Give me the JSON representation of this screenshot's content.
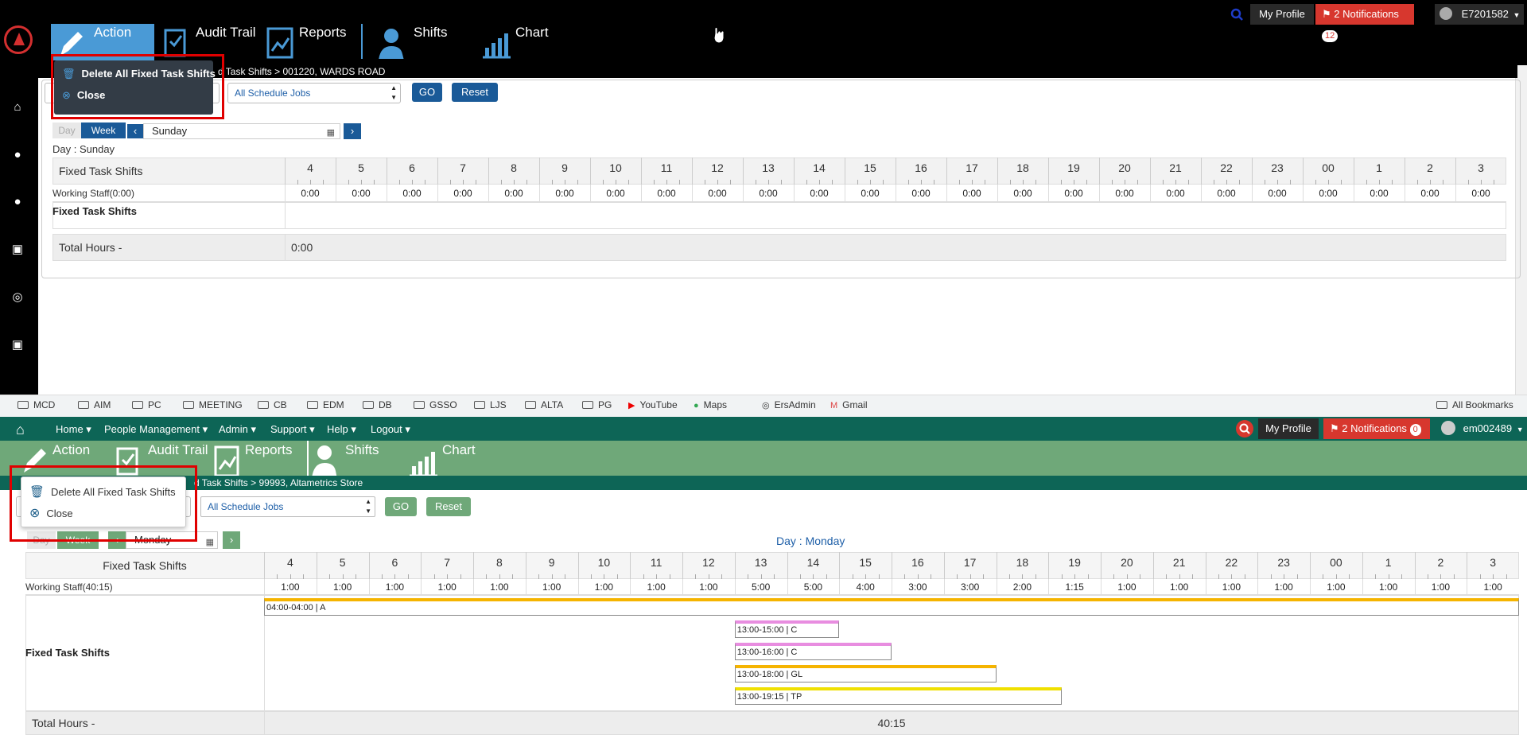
{
  "top": {
    "toolbar": {
      "action": "Action",
      "audit_trail": "Audit Trail",
      "reports": "Reports",
      "shifts": "Shifts",
      "chart": "Chart"
    },
    "header": {
      "my_profile": "My Profile",
      "notifications": "2 Notifications",
      "notif_count": "12",
      "user": "E7201582"
    },
    "breadcrumb": "d Task Shifts  > 001220, WARDS ROAD",
    "popup": {
      "delete": "Delete All Fixed Task Shifts",
      "close": "Close"
    },
    "filter": {
      "jobs": "All Schedule Jobs",
      "go": "GO",
      "reset": "Reset"
    },
    "view": {
      "day": "Day",
      "week": "Week",
      "date": "Sunday",
      "day_label": "Day : Sunday"
    },
    "table": {
      "header_label": "Fixed Task Shifts",
      "hours": [
        "4",
        "5",
        "6",
        "7",
        "8",
        "9",
        "10",
        "11",
        "12",
        "13",
        "14",
        "15",
        "16",
        "17",
        "18",
        "19",
        "20",
        "21",
        "22",
        "23",
        "00",
        "1",
        "2",
        "3"
      ],
      "working_staff_label": "Working Staff(0:00)",
      "working_staff": [
        "0:00",
        "0:00",
        "0:00",
        "0:00",
        "0:00",
        "0:00",
        "0:00",
        "0:00",
        "0:00",
        "0:00",
        "0:00",
        "0:00",
        "0:00",
        "0:00",
        "0:00",
        "0:00",
        "0:00",
        "0:00",
        "0:00",
        "0:00",
        "0:00",
        "0:00",
        "0:00",
        "0:00"
      ],
      "shifts_label": "Fixed Task Shifts",
      "total_label": "Total Hours -",
      "total_value": "0:00"
    }
  },
  "bookmarks": {
    "items": [
      "MCD",
      "AIM",
      "PC",
      "MEETING",
      "CB",
      "EDM",
      "DB",
      "GSSO",
      "LJS",
      "ALTA",
      "PG",
      "YouTube",
      "Maps",
      "ErsAdmin",
      "Gmail"
    ],
    "all": "All Bookmarks"
  },
  "bottom": {
    "nav": {
      "home": "Home",
      "people": "People Management",
      "admin": "Admin",
      "support": "Support",
      "help": "Help",
      "logout": "Logout",
      "my_profile": "My Profile",
      "notifications": "2 Notifications",
      "notif_count": "0",
      "user": "em002489"
    },
    "toolbar": {
      "action": "Action",
      "audit_trail": "Audit Trail",
      "reports": "Reports",
      "shifts": "Shifts",
      "chart": "Chart"
    },
    "breadcrumb": "d Task Shifts  > 99993, Altametrics Store",
    "popup": {
      "delete": "Delete All Fixed Task Shifts",
      "close": "Close"
    },
    "filter": {
      "jobs": "All Schedule Jobs",
      "go": "GO",
      "reset": "Reset"
    },
    "view": {
      "day": "Day",
      "week": "Week",
      "date": "Monday",
      "day_label": "Day : Monday"
    },
    "table": {
      "header_label": "Fixed Task Shifts",
      "hours": [
        "4",
        "5",
        "6",
        "7",
        "8",
        "9",
        "10",
        "11",
        "12",
        "13",
        "14",
        "15",
        "16",
        "17",
        "18",
        "19",
        "20",
        "21",
        "22",
        "23",
        "00",
        "1",
        "2",
        "3"
      ],
      "working_staff_label": "Working Staff(40:15)",
      "working_staff": [
        "1:00",
        "1:00",
        "1:00",
        "1:00",
        "1:00",
        "1:00",
        "1:00",
        "1:00",
        "1:00",
        "5:00",
        "5:00",
        "4:00",
        "3:00",
        "3:00",
        "2:00",
        "1:15",
        "1:00",
        "1:00",
        "1:00",
        "1:00",
        "1:00",
        "1:00",
        "1:00",
        "1:00"
      ],
      "shifts_label": "Fixed Task Shifts",
      "total_label": "Total Hours -",
      "total_value": "40:15",
      "shift_bars": [
        {
          "label": "04:00-04:00 | A",
          "start": 0,
          "end": 24,
          "color": "#f5b400"
        },
        {
          "label": "13:00-15:00 | C",
          "start": 9,
          "end": 11,
          "color": "#e88de0"
        },
        {
          "label": "13:00-16:00 | C",
          "start": 9,
          "end": 12,
          "color": "#e88de0"
        },
        {
          "label": "13:00-18:00 | GL",
          "start": 9,
          "end": 14,
          "color": "#f5b400"
        },
        {
          "label": "13:00-19:15 | TP",
          "start": 9,
          "end": 15.25,
          "color": "#f0e000"
        }
      ]
    }
  }
}
